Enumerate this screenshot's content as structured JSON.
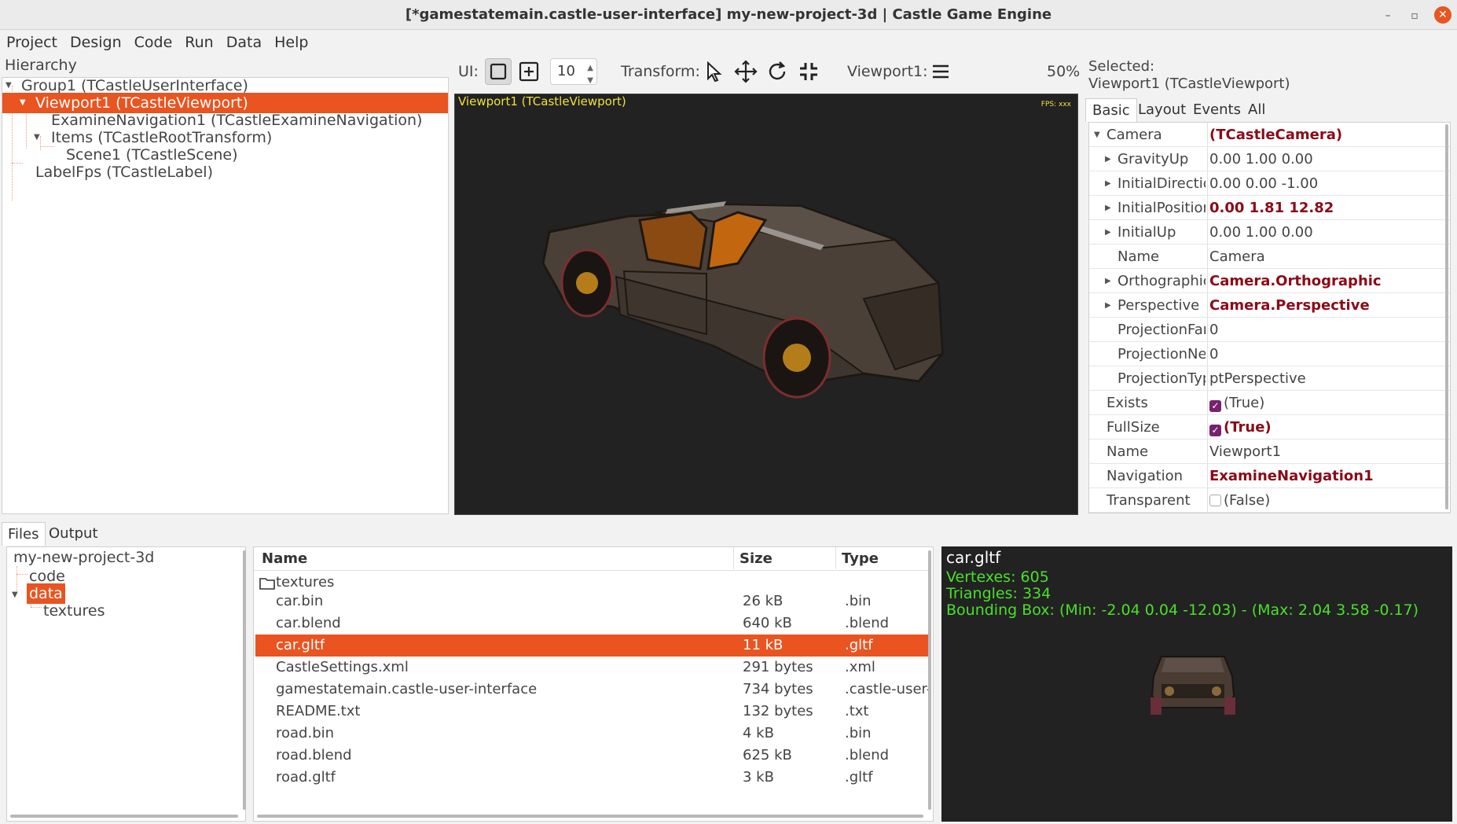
{
  "window": {
    "title": "[*gamestatemain.castle-user-interface] my-new-project-3d | Castle Game Engine",
    "minimize": "–",
    "maximize": "▫",
    "close": "✕"
  },
  "menu": [
    {
      "label": "Project"
    },
    {
      "label": "Design"
    },
    {
      "label": "Code"
    },
    {
      "label": "Run"
    },
    {
      "label": "Data"
    },
    {
      "label": "Help"
    }
  ],
  "hierarchy": {
    "label": "Hierarchy",
    "items": [
      {
        "label": "Group1 (TCastleUserInterface)"
      },
      {
        "label": "Viewport1 (TCastleViewport)"
      },
      {
        "label": "ExamineNavigation1 (TCastleExamineNavigation)"
      },
      {
        "label": "Items (TCastleRootTransform)"
      },
      {
        "label": "Scene1 (TCastleScene)"
      },
      {
        "label": "LabelFps (TCastleLabel)"
      }
    ]
  },
  "toolbar": {
    "ui_label": "UI:",
    "grid_value": "10",
    "transform_label": "Transform:",
    "viewport_label": "Viewport1:",
    "zoom": "50%"
  },
  "viewport": {
    "caption": "Viewport1 (TCastleViewport)",
    "fps": "FPS: xxx"
  },
  "inspector": {
    "selected_label": "Selected:",
    "selected_value": "Viewport1 (TCastleViewport)",
    "tabs": [
      "Basic",
      "Layout",
      "Events",
      "All"
    ],
    "props": [
      {
        "name": "Camera",
        "value": "(TCastleCamera)"
      },
      {
        "name": "GravityUp",
        "value": "0.00 1.00 0.00"
      },
      {
        "name": "InitialDirectio",
        "value": "0.00 0.00 -1.00"
      },
      {
        "name": "InitialPositior",
        "value": "0.00 1.81 12.82"
      },
      {
        "name": "InitialUp",
        "value": "0.00 1.00 0.00"
      },
      {
        "name": "Name",
        "value": "Camera"
      },
      {
        "name": "Orthographic",
        "value": "Camera.Orthographic"
      },
      {
        "name": "Perspective",
        "value": "Camera.Perspective"
      },
      {
        "name": "ProjectionFar",
        "value": "0"
      },
      {
        "name": "ProjectionNea",
        "value": "0"
      },
      {
        "name": "ProjectionTyp",
        "value": "ptPerspective"
      },
      {
        "name": "Exists",
        "value": "(True)"
      },
      {
        "name": "FullSize",
        "value": "(True)"
      },
      {
        "name": "Name",
        "value": "Viewport1"
      },
      {
        "name": "Navigation",
        "value": "ExamineNavigation1"
      },
      {
        "name": "Transparent",
        "value": "(False)"
      }
    ]
  },
  "bottom_tabs": [
    "Files",
    "Output"
  ],
  "files_tree": [
    {
      "label": "my-new-project-3d"
    },
    {
      "label": "code"
    },
    {
      "label": "data"
    },
    {
      "label": "textures"
    }
  ],
  "files_list": {
    "headers": {
      "name": "Name",
      "size": "Size",
      "type": "Type"
    },
    "rows": [
      {
        "name": "textures",
        "size": "",
        "type": ""
      },
      {
        "name": "car.bin",
        "size": "26 kB",
        "type": ".bin"
      },
      {
        "name": "car.blend",
        "size": "640 kB",
        "type": ".blend"
      },
      {
        "name": "car.gltf",
        "size": "11 kB",
        "type": ".gltf"
      },
      {
        "name": "CastleSettings.xml",
        "size": "291 bytes",
        "type": ".xml"
      },
      {
        "name": "gamestatemain.castle-user-interface",
        "size": "734 bytes",
        "type": ".castle-user-inte"
      },
      {
        "name": "README.txt",
        "size": "132 bytes",
        "type": ".txt"
      },
      {
        "name": "road.bin",
        "size": "4 kB",
        "type": ".bin"
      },
      {
        "name": "road.blend",
        "size": "625 kB",
        "type": ".blend"
      },
      {
        "name": "road.gltf",
        "size": "3 kB",
        "type": ".gltf"
      }
    ]
  },
  "preview": {
    "title": "car.gltf",
    "vertexes": "Vertexes: 605",
    "triangles": "Triangles: 334",
    "bbox": "Bounding Box: (Min: -2.04 0.04 -12.03) - (Max: 2.04 3.58 -0.17)"
  },
  "colors": {
    "selection": "#e95420",
    "modified_value": "#8b0a17",
    "checkbox": "#77216f",
    "viewport_caption": "#f1e03a",
    "preview_stats": "#49e02a"
  }
}
